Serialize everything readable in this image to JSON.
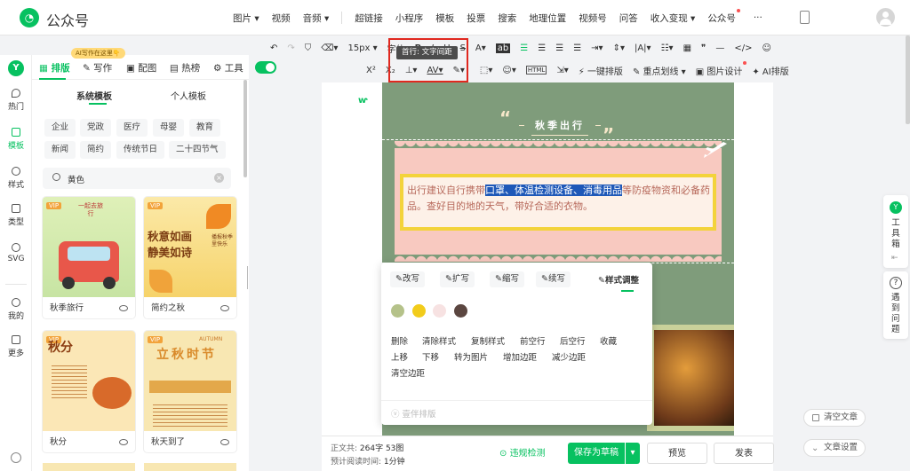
{
  "header": {
    "logo_text": "公众号",
    "menu_insert": [
      "图片",
      "视频",
      "音频"
    ],
    "menu_main": [
      "超链接",
      "小程序",
      "模板",
      "投票",
      "搜索",
      "地理位置",
      "视频号",
      "问答",
      "收入变现",
      "公众号"
    ],
    "more": "···",
    "icons": [
      "phone-preview-icon",
      "avatar-icon"
    ]
  },
  "toolbar": {
    "row1": {
      "font_size": "15px",
      "font_family": "字体",
      "buttons": [
        "undo",
        "redo",
        "format-painter",
        "clear-format",
        "bold",
        "italic",
        "underline",
        "strikethrough",
        "font-color",
        "background-color",
        "align-left",
        "align-center",
        "align-right",
        "justify",
        "indent",
        "line-height",
        "letter-spacing",
        "list",
        "table",
        "quote",
        "divider",
        "code",
        "emoji"
      ]
    },
    "tooltip": "首行: 文字间距",
    "row2": {
      "one_click_layout": "一键排版",
      "highlight_line": "重点划线",
      "image_design": "图片设计",
      "ai_layout": "AI排版"
    }
  },
  "left_rail": {
    "items": [
      "热门",
      "模板",
      "样式",
      "类型",
      "SVG",
      "我的",
      "更多"
    ],
    "active_index": 1
  },
  "side_panel": {
    "ai_badge": "AI写作在这里👇",
    "tabs": [
      "排版",
      "写作",
      "配图",
      "热榜",
      "工具"
    ],
    "active_tab": 0,
    "subtabs": [
      "系统模板",
      "个人模板"
    ],
    "active_subtab": 0,
    "chips": [
      "企业",
      "党政",
      "医疗",
      "母婴",
      "教育",
      "新闻",
      "简约",
      "传统节日",
      "二十四节气"
    ],
    "search": {
      "value": "黄色"
    },
    "cards": [
      {
        "label": "秋季旅行",
        "thumb_title": "一起去旅行",
        "thumb_badge": "VIP"
      },
      {
        "label": "简约之秋",
        "thumb_title": "秋意如画 静美如诗",
        "thumb_badge": "VIP",
        "thumb_sub": "播报秋季里快乐"
      },
      {
        "label": "秋分",
        "thumb_title": "秋分",
        "thumb_badge": "VIP"
      },
      {
        "label": "秋天到了",
        "thumb_title": "立秋时节",
        "thumb_badge": "VIP",
        "thumb_sub": "AUTUMN"
      }
    ]
  },
  "article": {
    "header_title": "秋季出行",
    "text_before": "出行建议自行携带",
    "text_selected": "口罩、体温检测设备、消毒用品",
    "text_after": "等防疫物资和必备药品。查好目的地的天气，带好合适的衣物。"
  },
  "popup": {
    "tabs": [
      "改写",
      "扩写",
      "缩写",
      "续写"
    ],
    "style_tab": "样式调整",
    "colors": [
      "#b5c28a",
      "#f2cc1b",
      "#f7e2e2",
      "#5b4640"
    ],
    "actions_row1": [
      "删除",
      "清除样式",
      "复制样式",
      "前空行",
      "后空行",
      "收藏"
    ],
    "actions_row2": [
      "上移",
      "下移",
      "转为图片",
      "增加边距",
      "减少边距"
    ],
    "actions_row3": [
      "清空边距"
    ],
    "footer": "壹伴排版"
  },
  "statusbar": {
    "word_count_label": "正文共:",
    "word_count": "264字 53图",
    "read_time_label": "预计阅读时间:",
    "read_time": "1分钟",
    "check": "违规检测",
    "save": "保存为草稿",
    "preview": "预览",
    "publish": "发表"
  },
  "right": {
    "toolbox": "工具箱",
    "help": "遇到问题",
    "clear_article": "清空文章",
    "article_settings": "文章设置"
  }
}
